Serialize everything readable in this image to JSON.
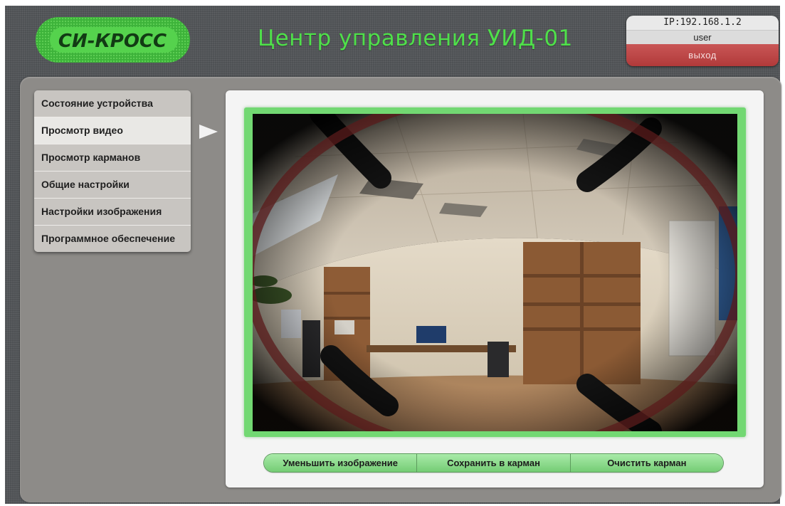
{
  "header": {
    "logo_text": "СИ-КРОСС",
    "title": "Центр управления УИД-01"
  },
  "session": {
    "ip": "IP:192.168.1.2",
    "user": "user",
    "logout_label": "выход"
  },
  "menu": {
    "items": [
      {
        "label": "Состояние устройства",
        "active": false
      },
      {
        "label": "Просмотр видео",
        "active": true
      },
      {
        "label": "Просмотр карманов",
        "active": false
      },
      {
        "label": "Общие настройки",
        "active": false
      },
      {
        "label": "Настройки изображения",
        "active": false
      },
      {
        "label": "Программное обеспечение",
        "active": false
      }
    ]
  },
  "video": {
    "frame_color": "#72d872"
  },
  "actions": {
    "shrink_label": "Уменьшить изображение",
    "save_label": "Сохранить в карман",
    "clear_label": "Очистить карман"
  },
  "colors": {
    "title_green": "#4fe04a",
    "logout_red": "#b13a3a",
    "button_green": "#75cc75"
  }
}
